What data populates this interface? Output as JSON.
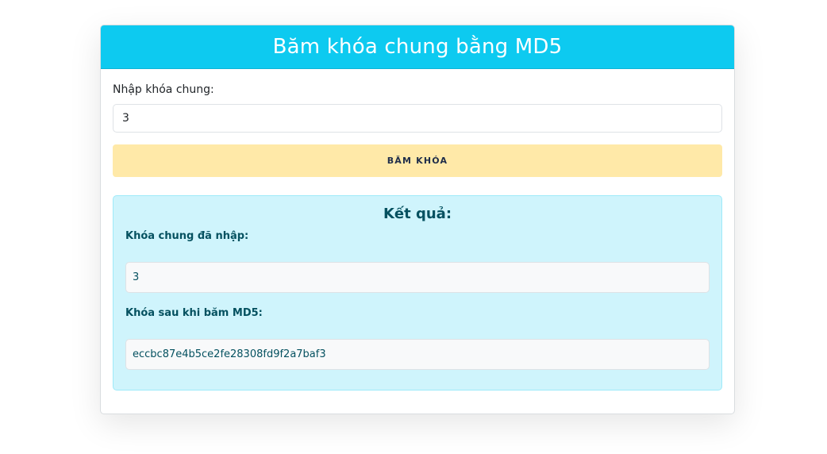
{
  "header": {
    "title": "Băm khóa chung bằng MD5"
  },
  "form": {
    "input_label": "Nhập khóa chung:",
    "input_value": "3",
    "submit_label": "BĂM KHÓA"
  },
  "result": {
    "title": "Kết quả:",
    "entered_label": "Khóa chung đã nhập:",
    "entered_value": "3",
    "hashed_label": "Khóa sau khi băm MD5:",
    "hashed_value": "eccbc87e4b5ce2fe28308fd9f2a7baf3"
  },
  "colors": {
    "header_bg": "#0dcaf0",
    "button_bg": "#ffe9a8",
    "result_bg": "#cff4fc",
    "result_text": "#055160"
  }
}
